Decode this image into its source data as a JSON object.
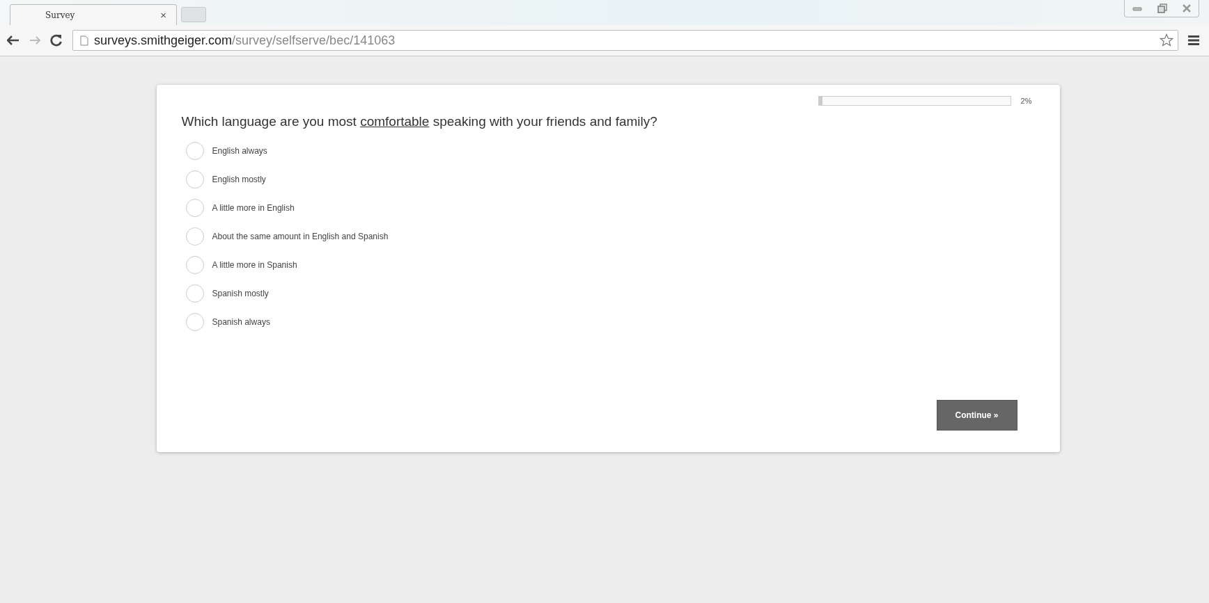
{
  "browser": {
    "tab": {
      "title": "Survey",
      "close": "×"
    },
    "address": {
      "host": "surveys.smithgeiger.com",
      "path": "/survey/selfserve/bec/141063"
    }
  },
  "survey": {
    "progress": {
      "level": 0.02,
      "reading": "2%"
    },
    "question": {
      "before": "Which language are you most ",
      "underlined": "comfortable",
      "after": " speaking with your friends and family?"
    },
    "options": [
      {
        "label": "English always",
        "selected": false
      },
      {
        "label": "English mostly",
        "selected": false
      },
      {
        "label": "A little more in English",
        "selected": false
      },
      {
        "label": "About the same amount in English and Spanish",
        "selected": false
      },
      {
        "label": "A little more in Spanish",
        "selected": false
      },
      {
        "label": "Spanish mostly",
        "selected": false
      },
      {
        "label": "Spanish always",
        "selected": false
      }
    ],
    "continue_button": "Continue »"
  }
}
